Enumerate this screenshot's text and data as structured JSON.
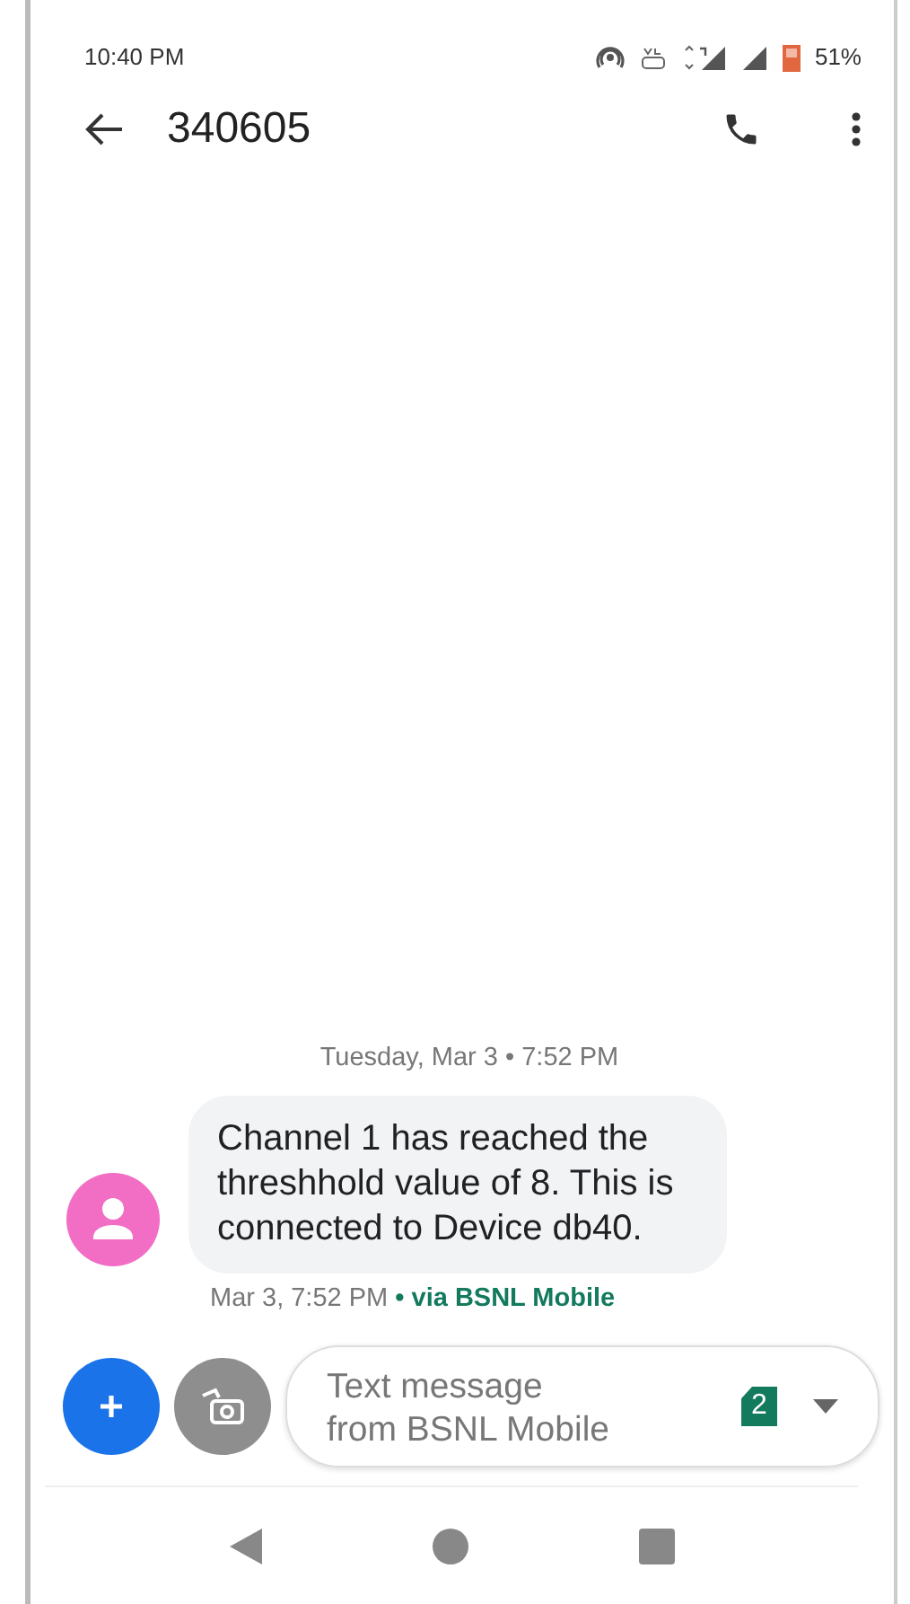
{
  "status_bar": {
    "time": "10:40 PM",
    "battery": "51%"
  },
  "header": {
    "title": "340605"
  },
  "conversation": {
    "date_divider": "Tuesday, Mar 3 • 7:52 PM",
    "messages": [
      {
        "text": "Channel 1 has reached the threshhold value of 8. This is connected to Device db40.",
        "time": "Mar 3, 7:52 PM",
        "via": "• via BSNL Mobile"
      }
    ]
  },
  "compose": {
    "placeholder": "Text message\nfrom BSNL Mobile",
    "sim": "2"
  }
}
